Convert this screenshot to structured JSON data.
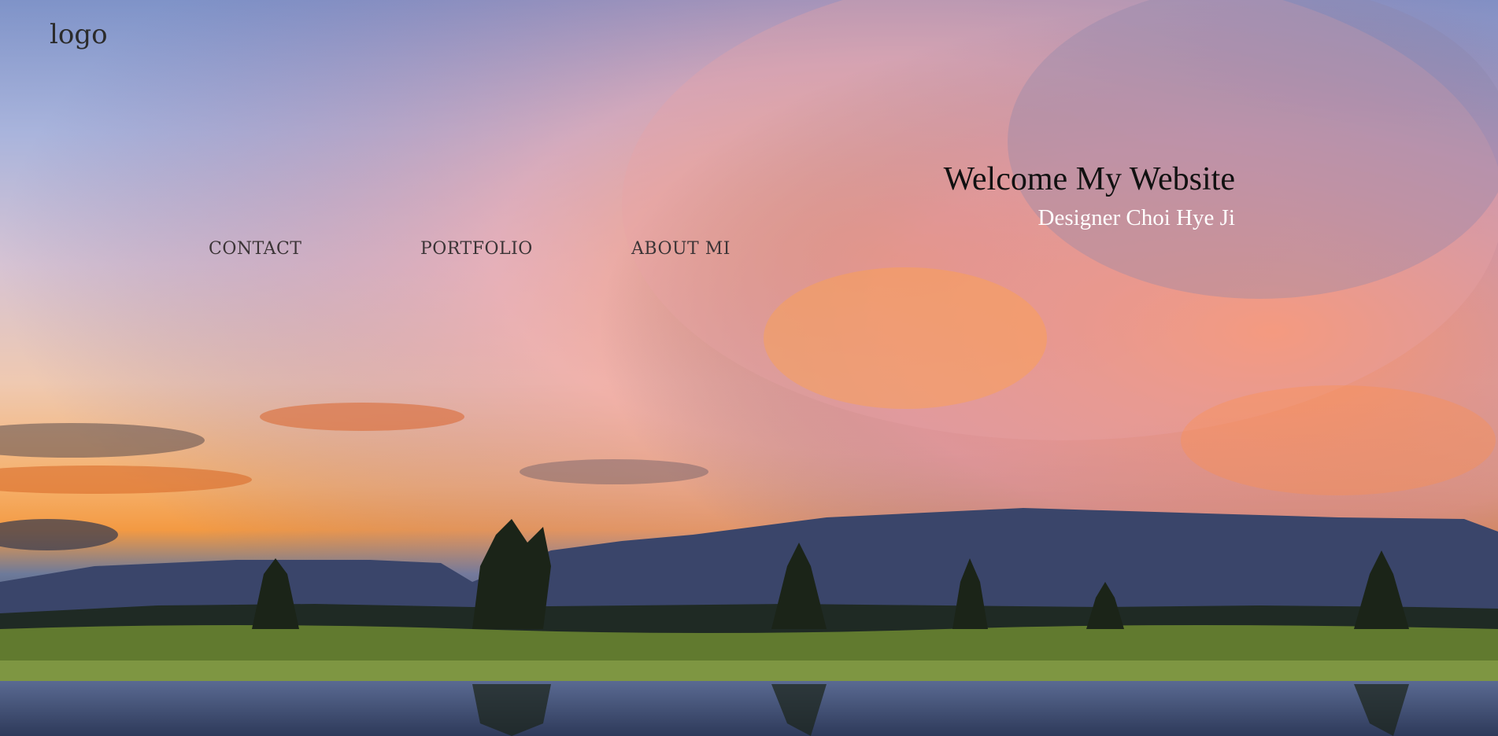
{
  "header": {
    "logo_text": "logo"
  },
  "nav": {
    "items": [
      {
        "label": "CONTACT"
      },
      {
        "label": "PORTFOLIO"
      },
      {
        "label": "ABOUT MI"
      }
    ]
  },
  "hero": {
    "title": "Welcome My Website",
    "subtitle": "Designer Choi Hye Ji"
  },
  "colors": {
    "nav_text": "#3b3436",
    "title_text": "#111111",
    "subtitle_text": "#ffffff"
  }
}
